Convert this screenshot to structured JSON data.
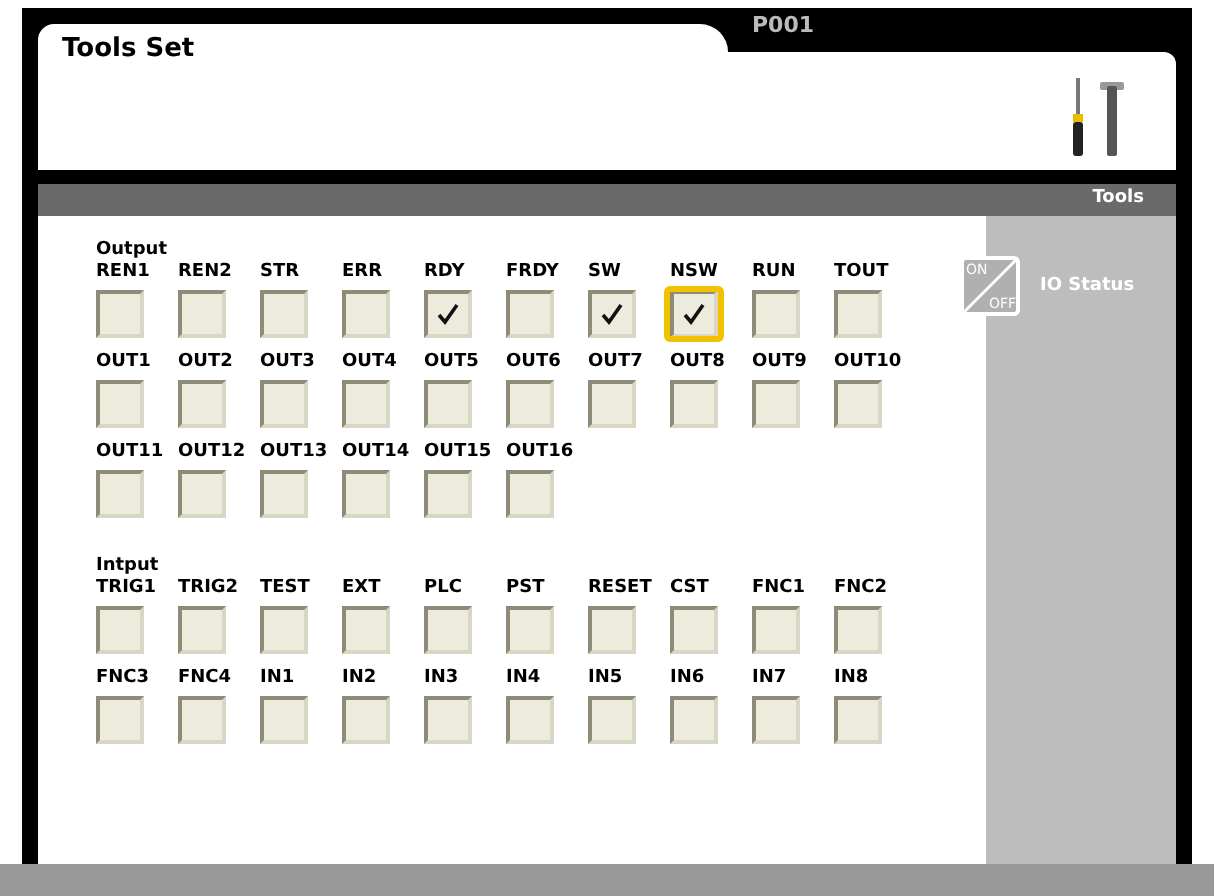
{
  "window": {
    "title": "Tools Set",
    "program": "P001"
  },
  "toolbar": {
    "title": "Tools"
  },
  "side_panel": {
    "on_label": "ON",
    "off_label": "OFF",
    "title": "IO Status"
  },
  "sections": [
    {
      "title": "Output",
      "rows": [
        [
          {
            "label": "REN1",
            "checked": false,
            "focused": false
          },
          {
            "label": "REN2",
            "checked": false,
            "focused": false
          },
          {
            "label": "STR",
            "checked": false,
            "focused": false
          },
          {
            "label": "ERR",
            "checked": false,
            "focused": false
          },
          {
            "label": "RDY",
            "checked": true,
            "focused": false
          },
          {
            "label": "FRDY",
            "checked": false,
            "focused": false
          },
          {
            "label": "SW",
            "checked": true,
            "focused": false
          },
          {
            "label": "NSW",
            "checked": true,
            "focused": true
          },
          {
            "label": "RUN",
            "checked": false,
            "focused": false
          },
          {
            "label": "TOUT",
            "checked": false,
            "focused": false
          }
        ],
        [
          {
            "label": "OUT1",
            "checked": false,
            "focused": false
          },
          {
            "label": "OUT2",
            "checked": false,
            "focused": false
          },
          {
            "label": "OUT3",
            "checked": false,
            "focused": false
          },
          {
            "label": "OUT4",
            "checked": false,
            "focused": false
          },
          {
            "label": "OUT5",
            "checked": false,
            "focused": false
          },
          {
            "label": "OUT6",
            "checked": false,
            "focused": false
          },
          {
            "label": "OUT7",
            "checked": false,
            "focused": false
          },
          {
            "label": "OUT8",
            "checked": false,
            "focused": false
          },
          {
            "label": "OUT9",
            "checked": false,
            "focused": false
          },
          {
            "label": "OUT10",
            "checked": false,
            "focused": false
          }
        ],
        [
          {
            "label": "OUT11",
            "checked": false,
            "focused": false
          },
          {
            "label": "OUT12",
            "checked": false,
            "focused": false
          },
          {
            "label": "OUT13",
            "checked": false,
            "focused": false
          },
          {
            "label": "OUT14",
            "checked": false,
            "focused": false
          },
          {
            "label": "OUT15",
            "checked": false,
            "focused": false
          },
          {
            "label": "OUT16",
            "checked": false,
            "focused": false
          }
        ]
      ]
    },
    {
      "title": "Intput",
      "rows": [
        [
          {
            "label": "TRIG1",
            "checked": false,
            "focused": false
          },
          {
            "label": "TRIG2",
            "checked": false,
            "focused": false
          },
          {
            "label": "TEST",
            "checked": false,
            "focused": false
          },
          {
            "label": "EXT",
            "checked": false,
            "focused": false
          },
          {
            "label": "PLC",
            "checked": false,
            "focused": false
          },
          {
            "label": "PST",
            "checked": false,
            "focused": false
          },
          {
            "label": "RESET",
            "checked": false,
            "focused": false
          },
          {
            "label": "CST",
            "checked": false,
            "focused": false
          },
          {
            "label": "FNC1",
            "checked": false,
            "focused": false
          },
          {
            "label": "FNC2",
            "checked": false,
            "focused": false
          }
        ],
        [
          {
            "label": "FNC3",
            "checked": false,
            "focused": false
          },
          {
            "label": "FNC4",
            "checked": false,
            "focused": false
          },
          {
            "label": "IN1",
            "checked": false,
            "focused": false
          },
          {
            "label": "IN2",
            "checked": false,
            "focused": false
          },
          {
            "label": "IN3",
            "checked": false,
            "focused": false
          },
          {
            "label": "IN4",
            "checked": false,
            "focused": false
          },
          {
            "label": "IN5",
            "checked": false,
            "focused": false
          },
          {
            "label": "IN6",
            "checked": false,
            "focused": false
          },
          {
            "label": "IN7",
            "checked": false,
            "focused": false
          },
          {
            "label": "IN8",
            "checked": false,
            "focused": false
          }
        ]
      ]
    }
  ]
}
